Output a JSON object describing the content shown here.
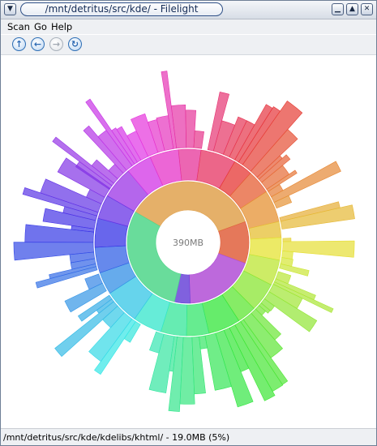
{
  "window": {
    "title": "/mnt/detritus/src/kde/ - Filelight",
    "menu_icon": "down-arrow-icon",
    "controls": [
      "minimize-icon",
      "maximize-icon",
      "close-icon"
    ]
  },
  "menu": {
    "items": [
      "Scan",
      "Go",
      "Help"
    ]
  },
  "toolbar": {
    "buttons": [
      {
        "icon": "up-arrow-icon",
        "enabled": true
      },
      {
        "icon": "back-arrow-icon",
        "enabled": true
      },
      {
        "icon": "forward-arrow-icon",
        "enabled": false
      },
      {
        "icon": "refresh-icon",
        "enabled": true
      }
    ]
  },
  "map": {
    "center_label": "390MB",
    "inner_ring_colors": [
      "#e0a24f",
      "#e0603d",
      "#b14fd6",
      "#6a45d8",
      "#4fd68a"
    ]
  },
  "status": {
    "text": "/mnt/detritus/src/kde/kdelibs/khtml/ - 19.0MB (5%)"
  },
  "colors": {
    "window_border": "#6f7f96",
    "title_text": "#132a55",
    "center_circle": "#ffffff"
  }
}
